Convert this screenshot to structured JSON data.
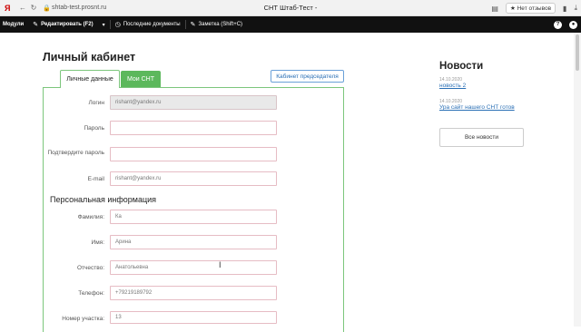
{
  "browser": {
    "logo": "Я",
    "url": "shtab-test.prosnt.ru",
    "title": "СНТ Штаб-Тест -",
    "reviews": "★ Нет отзывов"
  },
  "toolbar": {
    "modules": "Модули",
    "edit": "Редактировать (F2)",
    "recent_docs": "Последние документы",
    "note": "Заметка (Shift+C)"
  },
  "page": {
    "title": "Личный кабинет",
    "tabs": [
      "Личные данные",
      "Мои СНТ"
    ],
    "chair_button": "Кабинет председателя",
    "section_personal": "Персональная информация"
  },
  "form": {
    "login_label": "Логин",
    "login_value": "rishant@yandex.ru",
    "password_label": "Пароль",
    "password_value": "",
    "confirm_label": "Подтвердите пароль",
    "confirm_value": "",
    "email_label": "E-mail",
    "email_value": "rishant@yandex.ru",
    "surname_label": "Фамилия:",
    "surname_value": "Ка",
    "name_label": "Имя:",
    "name_value": "Арина",
    "patronymic_label": "Отчество:",
    "patronymic_value": "Анатольевна",
    "phone_label": "Телефон:",
    "phone_value": "+79219189792",
    "plot_label": "Номер участка:",
    "plot_value": "13"
  },
  "news": {
    "title": "Новости",
    "items": [
      {
        "date": "14.10.2020",
        "title": "новость 2"
      },
      {
        "date": "14.10.2020",
        "title": "Ура сайт нашего СНТ готов"
      }
    ],
    "all_button": "Все новости"
  }
}
